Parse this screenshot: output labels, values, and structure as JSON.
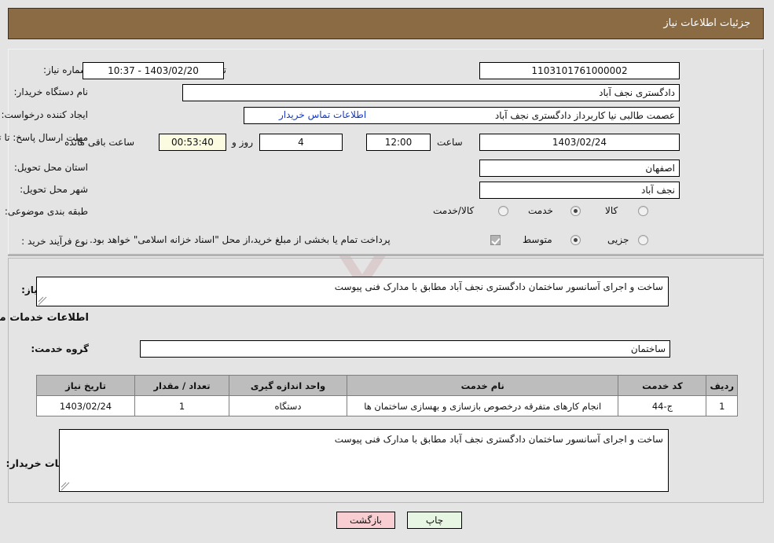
{
  "header": {
    "title": "جزئیات اطلاعات نیاز"
  },
  "watermark": {
    "text": "AriaTender.net"
  },
  "top_form": {
    "need_number_label": "شماره نیاز:",
    "need_number_value": "1103101761000002",
    "announce_datetime_label": "تاریخ و ساعت اعلان عمومی:",
    "announce_datetime_value": "1403/02/20 - 10:37",
    "buyer_org_label": "نام دستگاه خریدار:",
    "buyer_org_value": "دادگستری نجف آباد",
    "creator_label": "ایجاد کننده درخواست:",
    "creator_value": "عصمت طالبی نیا کاربرداز دادگستری نجف آباد",
    "contact_link": "اطلاعات تماس خریدار",
    "deadline_label": "مهلت ارسال پاسخ: تا تاریخ:",
    "deadline_date_value": "1403/02/24",
    "deadline_hour_label": "ساعت",
    "deadline_hour_value": "12:00",
    "remaining_days_value": "4",
    "remaining_days_label": "روز و",
    "remaining_time_value": "00:53:40",
    "remaining_time_label": "ساعت باقی مانده",
    "province_label": "استان محل تحویل:",
    "province_value": "اصفهان",
    "city_label": "شهر محل تحویل:",
    "city_value": "نجف آباد",
    "category_label": "طبقه بندی موضوعی:",
    "category_options": [
      {
        "label": "کالا",
        "selected": false
      },
      {
        "label": "خدمت",
        "selected": true
      },
      {
        "label": "کالا/خدمت",
        "selected": false
      }
    ],
    "process_label": "نوع فرآیند خرید :",
    "process_options": [
      {
        "label": "جزیی",
        "selected": false
      },
      {
        "label": "متوسط",
        "selected": true
      }
    ],
    "treasury_checkbox_label": "پرداخت تمام یا بخشی از مبلغ خرید،از محل \"اسناد خزانه اسلامی\" خواهد بود.",
    "treasury_checked": true
  },
  "middle": {
    "general_desc_label": "شرح کلی نیاز:",
    "general_desc_value": "ساخت و اجرای آسانسور ساختمان دادگستری نجف آباد مطابق با مدارک فنی پیوست",
    "services_section_title": "اطلاعات خدمات مورد نیاز",
    "service_group_label": "گروه خدمت:",
    "service_group_value": "ساختمان",
    "buyer_notes_label": "توضیحات خریدار:",
    "buyer_notes_value": "ساخت و اجرای آسانسور ساختمان دادگستری نجف آباد مطابق با مدارک فنی پیوست"
  },
  "table": {
    "columns": [
      "ردیف",
      "کد خدمت",
      "نام خدمت",
      "واحد اندازه گیری",
      "تعداد / مقدار",
      "تاریخ نیاز"
    ],
    "rows": [
      {
        "row_no": "1",
        "service_code": "ج-44",
        "service_name": "انجام کارهای متفرقه درخصوص بازسازی و بهسازی ساختمان ها",
        "unit": "دستگاه",
        "quantity": "1",
        "need_date": "1403/02/24"
      }
    ]
  },
  "footer": {
    "print_label": "چاپ",
    "back_label": "بازگشت"
  },
  "colors": {
    "header_bg": "#8b6b43",
    "page_bg": "#e4e4e4",
    "link": "#1539c9",
    "highlight_yellow": "#fbfbe2",
    "print_btn": "#e7f6e2",
    "back_btn": "#f9ced2",
    "table_header": "#bdbdbd"
  }
}
